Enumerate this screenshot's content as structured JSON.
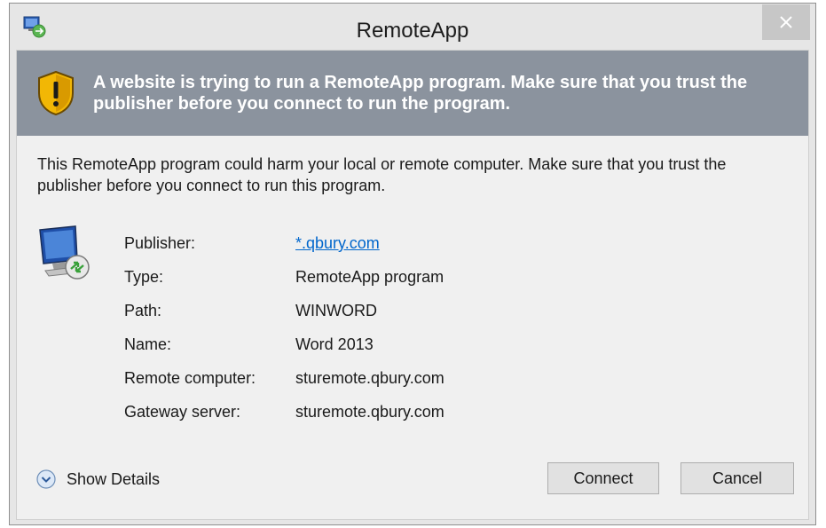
{
  "window": {
    "title": "RemoteApp",
    "close_glyph": "✕"
  },
  "banner": {
    "icon": "shield-warning-icon",
    "text": "A website is trying to run a RemoteApp program. Make sure that you trust the publisher before you connect to run the program."
  },
  "warning": {
    "text": "This RemoteApp program could harm your local or remote computer. Make sure that you trust the publisher before you connect to run this program."
  },
  "details": {
    "icon": "remote-computer-icon",
    "rows": [
      {
        "label": "Publisher:",
        "value": "*.qbury.com",
        "is_link": true
      },
      {
        "label": "Type:",
        "value": "RemoteApp program"
      },
      {
        "label": "Path:",
        "value": "WINWORD"
      },
      {
        "label": "Name:",
        "value": "Word 2013"
      },
      {
        "label": "Remote computer:",
        "value": "sturemote.qbury.com"
      },
      {
        "label": "Gateway server:",
        "value": "sturemote.qbury.com"
      }
    ]
  },
  "footer": {
    "show_details_label": "Show Details",
    "connect_label": "Connect",
    "cancel_label": "Cancel"
  },
  "colors": {
    "banner_bg": "#8b939e",
    "panel_bg": "#f0f0f0",
    "window_bg": "#e6e6e6",
    "link": "#0066cc",
    "close_bg": "#c7c7c7"
  }
}
